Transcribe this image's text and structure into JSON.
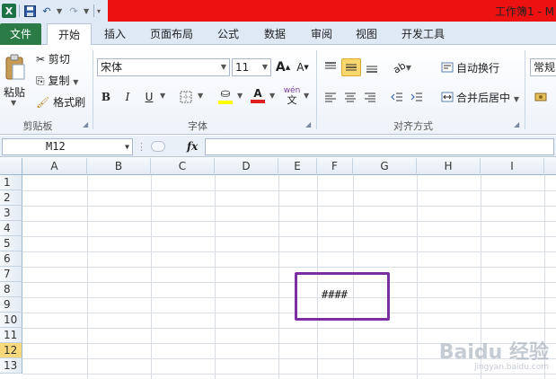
{
  "titlebar": {
    "title": "工作簿1 - M"
  },
  "tabs": [
    "文件",
    "开始",
    "插入",
    "页面布局",
    "公式",
    "数据",
    "审阅",
    "视图",
    "开发工具"
  ],
  "ribbon": {
    "clipboard": {
      "paste": "粘贴",
      "cut": "剪切",
      "copy": "复制",
      "format_painter": "格式刷",
      "group": "剪贴板"
    },
    "font": {
      "name": "宋体",
      "size": "11",
      "bold": "B",
      "italic": "I",
      "underline": "U",
      "grow": "A",
      "shrink": "A",
      "font_color": "A",
      "phonetic": "wén",
      "group": "字体"
    },
    "alignment": {
      "wrap_text": "自动换行",
      "merge_center": "合并后居中",
      "group": "对齐方式"
    },
    "number": {
      "format": "常规"
    }
  },
  "formula_bar": {
    "name_box": "M12",
    "fx": "fx",
    "value": ""
  },
  "sheet": {
    "columns": [
      "A",
      "B",
      "C",
      "D",
      "E",
      "F",
      "G",
      "H",
      "I"
    ],
    "rows": [
      "1",
      "2",
      "3",
      "4",
      "5",
      "6",
      "7",
      "8",
      "9",
      "10",
      "11",
      "12",
      "13"
    ],
    "active_row": "12",
    "cell_text": "####"
  },
  "watermark": {
    "main": "Baidu 经验",
    "sub": "jingyan.baidu.com"
  },
  "colors": {
    "file_tab": "#2a7b46",
    "highlight": "#7b2fa0",
    "title_red": "#ee1111",
    "active_row": "#f9d97b"
  }
}
